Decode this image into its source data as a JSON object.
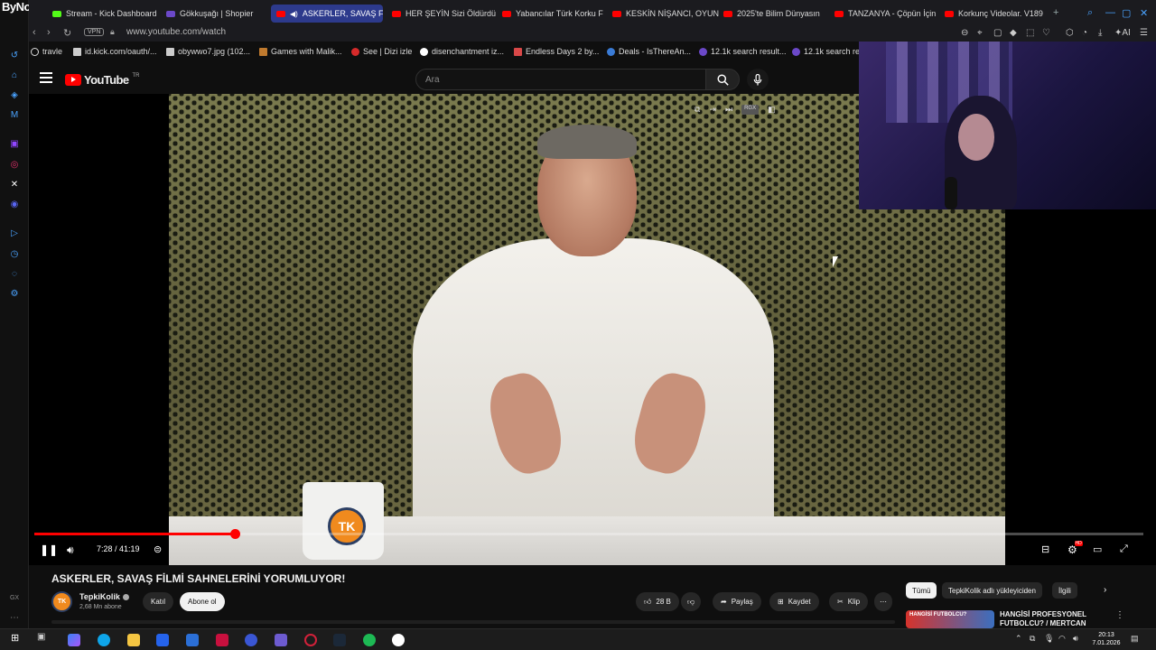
{
  "overlay": {
    "watermark": "ByNoGame"
  },
  "tabs": [
    {
      "label": "Stream - Kick Dashboard",
      "icon": "kick-icon"
    },
    {
      "label": "Gökkuşağı | Shopier",
      "icon": "shopier-icon"
    },
    {
      "label": "ASKERLER, SAVAŞ Fİ...",
      "icon": "youtube-icon",
      "active": true
    },
    {
      "label": "HER ŞEYİN Sizi Öldürdü",
      "icon": "youtube-icon"
    },
    {
      "label": "Yabancılar Türk Korku F",
      "icon": "youtube-icon"
    },
    {
      "label": "KESKİN NİŞANCI, OYUN",
      "icon": "youtube-icon"
    },
    {
      "label": "2025'te Bilim Dünyasın",
      "icon": "youtube-icon"
    },
    {
      "label": "TANZANYA - Çöpün İçin",
      "icon": "youtube-icon"
    },
    {
      "label": "Korkunç Videolar. V189",
      "icon": "youtube-icon"
    }
  ],
  "address": {
    "vpn": "VPN",
    "url": "www.youtube.com/watch"
  },
  "bookmarks": [
    {
      "label": "travle"
    },
    {
      "label": "id.kick.com/oauth/..."
    },
    {
      "label": "obywwo7.jpg (102..."
    },
    {
      "label": "Games with Malik..."
    },
    {
      "label": "See | Dizi izle"
    },
    {
      "label": "disenchantment iz..."
    },
    {
      "label": "Endless Days 2 by..."
    },
    {
      "label": "Deals - IsThereAn..."
    },
    {
      "label": "12.1k search result..."
    },
    {
      "label": "12.1k search res"
    }
  ],
  "youtube": {
    "logo_text": "YouTube",
    "region": "TR",
    "search_placeholder": "Ara"
  },
  "player": {
    "time": "7:28 / 41:19",
    "progress_fraction": 0.181,
    "overlay_badge": "RGX",
    "mug_logo": "TK"
  },
  "video": {
    "title": "ASKERLER, SAVAŞ FİLMİ SAHNELERİNİ YORUMLUYOR!",
    "channel_name": "TepkiKolik",
    "channel_avatar_text": "TK",
    "subscribers": "2,68 Mn abone",
    "join_label": "Katıl",
    "subscribe_label": "Abone ol",
    "likes": "28 B",
    "share_label": "Paylaş",
    "save_label": "Kaydet",
    "clip_label": "Klip"
  },
  "related": {
    "chips": [
      "Tümü",
      "TepkiKolik adlı yükleyiciden",
      "İlgili"
    ],
    "first_title": "HANGİSİ PROFESYONEL FUTBOLCU? / MERTCAN",
    "thumb_text": "HANGİSİ FUTBOLCU?"
  },
  "taskbar": {
    "time": "20:13",
    "date": "7.01.2026"
  },
  "colors": {
    "accent": "#ff0000",
    "background": "#0f0f0f",
    "active_tab": "#2d3a8c"
  }
}
